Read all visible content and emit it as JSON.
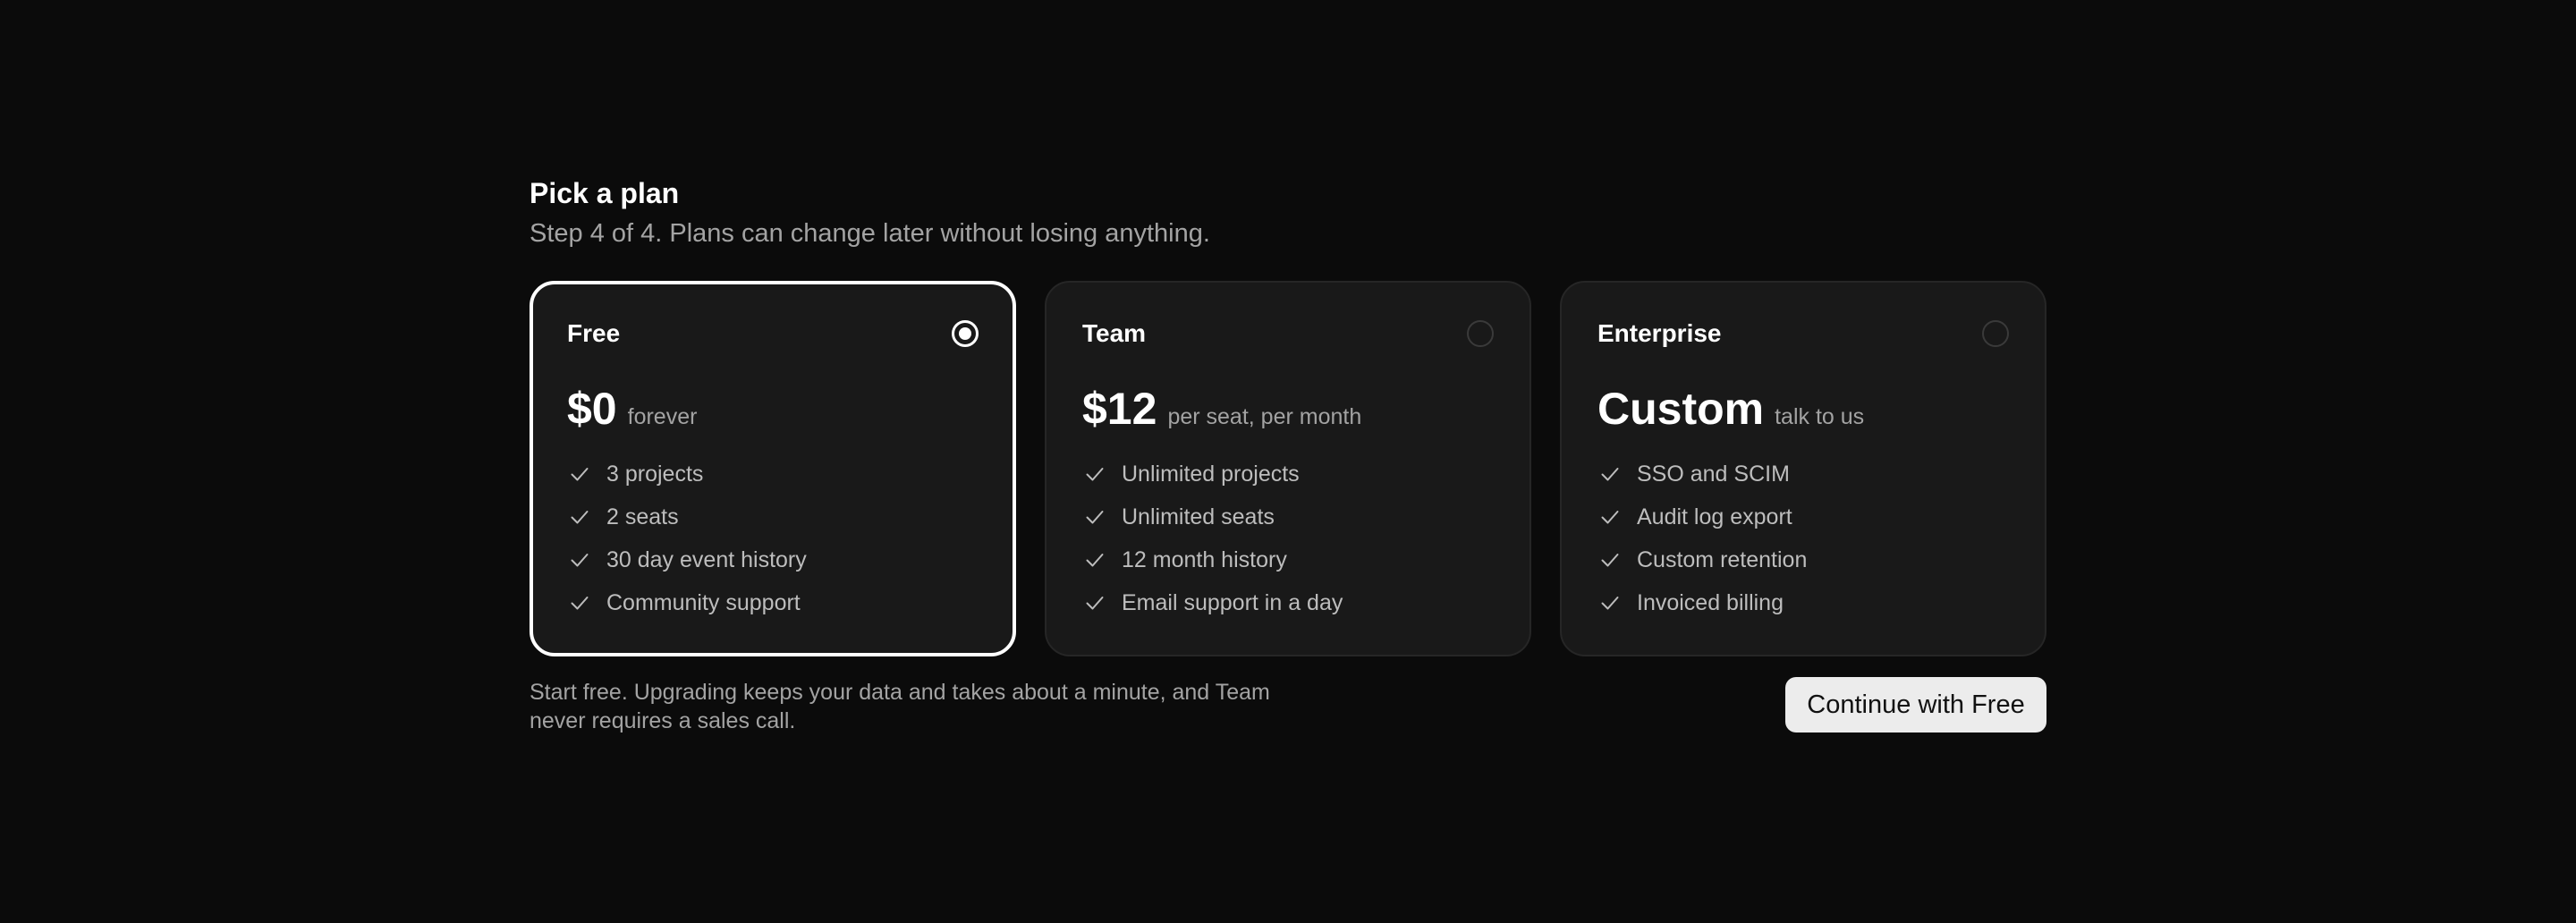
{
  "header": {
    "title": "Pick a plan",
    "subtitle": "Step 4 of 4. Plans can change later without losing anything."
  },
  "plans": [
    {
      "name": "Free",
      "price": "$0",
      "price_note": "forever",
      "selected": true,
      "features": [
        "3 projects",
        "2 seats",
        "30 day event history",
        "Community support"
      ]
    },
    {
      "name": "Team",
      "price": "$12",
      "price_note": "per seat, per month",
      "selected": false,
      "features": [
        "Unlimited projects",
        "Unlimited seats",
        "12 month history",
        "Email support in a day"
      ]
    },
    {
      "name": "Enterprise",
      "price": "Custom",
      "price_note": "talk to us",
      "selected": false,
      "features": [
        "SSO and SCIM",
        "Audit log export",
        "Custom retention",
        "Invoiced billing"
      ]
    }
  ],
  "footer": {
    "note": "Start free. Upgrading keeps your data and takes about a minute, and Team never requires a sales call.",
    "continue_label": "Continue with Free"
  },
  "icons": {
    "feature": "check-icon",
    "selector": "radio-icon"
  },
  "colors": {
    "background": "#0b0b0b",
    "card": "#191919",
    "selected_border": "#ffffff",
    "button": "#ececec"
  }
}
